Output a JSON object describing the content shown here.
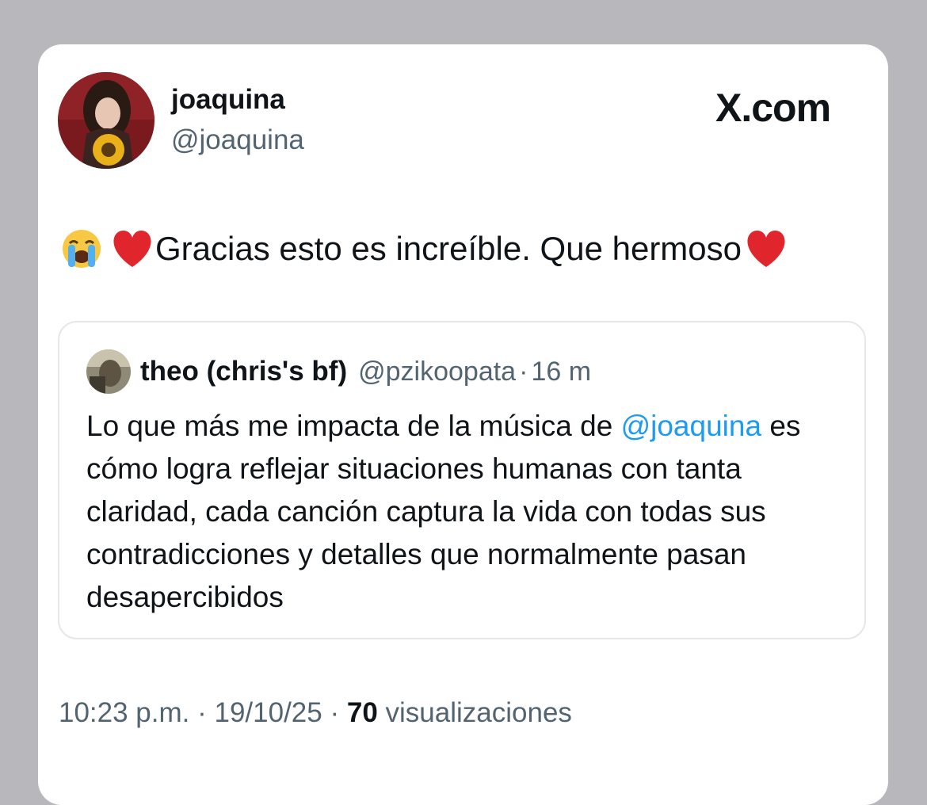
{
  "author": {
    "name": "joaquina",
    "handle": "@joaquina"
  },
  "brand": "X.com",
  "tweet": {
    "text": "Gracias esto es increíble. Que hermoso",
    "emojis": [
      "loudly-crying-face-icon",
      "red-heart-icon",
      "red-heart-icon"
    ]
  },
  "quote": {
    "name": "theo (chris's bf)",
    "handle": "@pzikoopata",
    "separator": "·",
    "time": "16 m",
    "text_before_mention": "Lo que más me impacta de la música de ",
    "mention": "@joaquina",
    "text_after_mention": " es cómo logra reflejar situaciones humanas con tanta claridad, cada canción captura la vida con todas sus contradicciones y detalles que normalmente pasan desapercibidos"
  },
  "meta": {
    "time": "10:23 p.m.",
    "sep1": " · ",
    "date": "19/10/25",
    "sep2": " · ",
    "views_count": "70",
    "views_label": " visualizaciones"
  },
  "colors": {
    "background": "#b8b8bc",
    "card": "#ffffff",
    "text_primary": "#0f1419",
    "text_secondary": "#536471",
    "mention": "#1d9bf0",
    "heart": "#e0262c",
    "border": "#e4e8eb"
  }
}
